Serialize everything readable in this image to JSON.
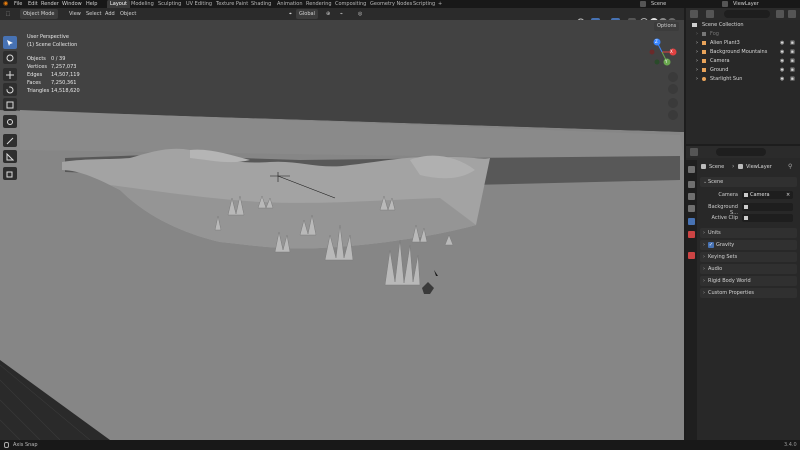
{
  "menu": {
    "items": [
      "File",
      "Edit",
      "Render",
      "Window",
      "Help"
    ],
    "workspaces": [
      "Layout",
      "Modeling",
      "Sculpting",
      "UV Editing",
      "Texture Paint",
      "Shading",
      "Animation",
      "Rendering",
      "Compositing",
      "Geometry Nodes",
      "Scripting"
    ],
    "add_tab": "+",
    "scene_name": "Scene",
    "view_layer_name": "ViewLayer"
  },
  "viewport_header": {
    "mode": "Object Mode",
    "menus": [
      "View",
      "Select",
      "Add",
      "Object"
    ],
    "orientation": "Global",
    "options_label": "Options"
  },
  "overlay": {
    "view_name": "User Perspective",
    "collection": "(1) Scene Collection",
    "stats": [
      {
        "label": "Objects",
        "value": "0 / 39"
      },
      {
        "label": "Vertices",
        "value": "7,257,073"
      },
      {
        "label": "Edges",
        "value": "14,507,119"
      },
      {
        "label": "Faces",
        "value": "7,250,361"
      },
      {
        "label": "Triangles",
        "value": "14,518,620"
      }
    ]
  },
  "gizmo": {
    "x": "X",
    "y": "Y",
    "z": "Z"
  },
  "outliner": {
    "root": "Scene Collection",
    "items": [
      {
        "label": "Fog",
        "dimmed": true
      },
      {
        "label": "Alien Plant3",
        "dimmed": false
      },
      {
        "label": "Background Mountains",
        "dimmed": false
      },
      {
        "label": "Camera",
        "dimmed": false
      },
      {
        "label": "Ground",
        "dimmed": false
      },
      {
        "label": "Starlight Sun",
        "dimmed": false
      }
    ]
  },
  "properties": {
    "breadcrumb_scene": "Scene",
    "breadcrumb_sep": "›",
    "breadcrumb_layer": "ViewLayer",
    "scene_panel": "Scene",
    "camera_label": "Camera",
    "camera_value": "Camera",
    "background_label": "Background S...",
    "active_clip_label": "Active Clip",
    "panels": [
      "Units",
      "Gravity",
      "Keying Sets",
      "Audio",
      "Rigid Body World",
      "Custom Properties"
    ]
  },
  "status": {
    "left": "Axis Snap",
    "version": "3.4.0"
  },
  "colors": {
    "accent": "#4772b3",
    "viewport_bg": "#3e3e3e",
    "header_bg": "#2b2b2b"
  }
}
